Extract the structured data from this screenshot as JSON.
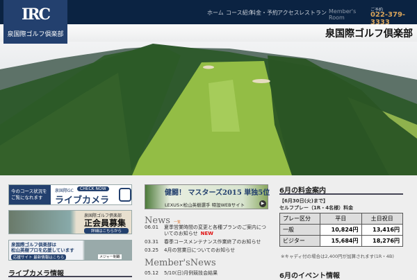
{
  "logo": {
    "monogram": "IRC",
    "name": "泉国際ゴルフ倶楽部"
  },
  "nav": [
    "ホーム",
    "コース紹介",
    "料金・予約",
    "アクセス",
    "レストラン"
  ],
  "member_room": [
    "Member's",
    "Room"
  ],
  "tel": {
    "label": "ご予約",
    "number": "022-379-3333"
  },
  "site_title": "泉国際ゴルフ倶楽部",
  "banners": {
    "live": {
      "left": [
        "今のコース状況を",
        "ご覧になれます"
      ],
      "brand": "泉国際GC",
      "badge": "CHECK NOW",
      "title": "ライブカメラ"
    },
    "recruit": {
      "sub": "泉国際ゴルフ倶楽部",
      "title": "正会員募集",
      "link": "詳細はこちらから"
    },
    "support": {
      "l1": "泉国際ゴルフ倶楽部は",
      "l2": "松山英樹プロを応援しています",
      "link": "応援サイト 最新情報はこちら",
      "tag": "メジャー制覇"
    },
    "masters": {
      "title": "健闘！ マスターズ2015 単独5位",
      "sub": "LEXUS×松山英樹選手 特設WEBサイト"
    }
  },
  "left_heading": "ライブカメラ情報",
  "news": {
    "title": "News",
    "more": "一覧",
    "items": [
      {
        "date": "06.01",
        "text": "夏季営業時間の変更と各種プランのご案内についてのお知らせ",
        "new": "NEW"
      },
      {
        "date": "03.31",
        "text": "春季コースメンテナンス作業終了のお知らせ"
      },
      {
        "date": "03.25",
        "text": "4月の営業日についてのお知らせ"
      }
    ]
  },
  "member_news": {
    "title": "Member'sNews",
    "items": [
      {
        "date": "05.12",
        "text": "5/10(日)月例競技会結果"
      }
    ]
  },
  "fees": {
    "title": "6月の料金案内",
    "line1": "【6月30日(火)まで】",
    "line2": "セルフプレー（1R・4名様）料金",
    "headers": [
      "プレー区分",
      "平日",
      "土日祝日"
    ],
    "rows": [
      {
        "label": "一般",
        "weekday": "10,824円",
        "weekend": "13,416円"
      },
      {
        "label": "ビジター",
        "weekday": "15,684円",
        "weekend": "18,276円"
      }
    ],
    "note": "※キャディ付の場合は2,400円が加算されます(1R・4B)"
  },
  "next_heading": "6月のイベント情報"
}
